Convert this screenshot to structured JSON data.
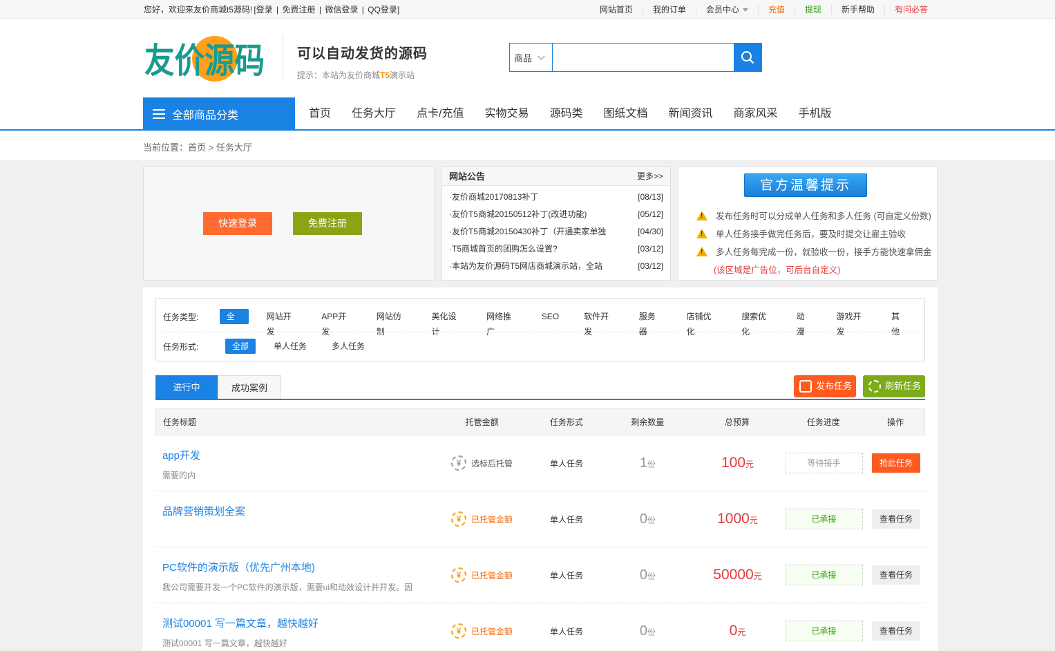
{
  "topbar": {
    "welcome": "您好，欢迎来友价商城t5源码!",
    "login": "[登录",
    "register": "免费注册",
    "wechat": "微信登录",
    "qq": "QQ登录]",
    "sep": "|",
    "nav": [
      "网站首页",
      "我的订单",
      "会员中心",
      "充值",
      "提现",
      "新手帮助",
      "有问必答"
    ]
  },
  "header": {
    "logo_text": "友价源码",
    "slogan": "可以自动发货的源码",
    "hint_prefix": "提示：本站为友价商城",
    "hint_brand": "T5",
    "hint_suffix": "演示站",
    "search_type": "商品",
    "search_placeholder": ""
  },
  "mainnav": {
    "all_categories": "全部商品分类",
    "items": [
      "首页",
      "任务大厅",
      "点卡/充值",
      "实物交易",
      "源码类",
      "图纸文档",
      "新闻资讯",
      "商家风采",
      "手机版"
    ]
  },
  "breadcrumb": "当前位置：首页 > 任务大厅",
  "login_panel": {
    "quick_login": "快速登录",
    "free_register": "免费注册"
  },
  "notice": {
    "title": "网站公告",
    "more": "更多>>",
    "items": [
      {
        "title": "·友价商城20170813补丁",
        "date": "[08/13]"
      },
      {
        "title": "·友价T5商城20150512补丁(改进功能)",
        "date": "[05/12]"
      },
      {
        "title": "·友价T5商城20150430补丁（开通卖家单独",
        "date": "[04/30]"
      },
      {
        "title": "·T5商城首页的团购怎么设置?",
        "date": "[03/12]"
      },
      {
        "title": "·本站为友价源码T5网店商城演示站，全站",
        "date": "[03/12]"
      }
    ]
  },
  "tips": {
    "title": "官方温馨提示",
    "items": [
      "发布任务时可以分成单人任务和多人任务 (可自定义份数)",
      "单人任务接手做完任务后，要及时提交让雇主验收",
      "多人任务每完成一份，就验收一份，接手方能快速拿佣金"
    ],
    "ad": "(该区域是广告位，可后台自定义)"
  },
  "filter": {
    "type_label": "任务类型:",
    "types": [
      "全部",
      "网站开发",
      "APP开发",
      "网站仿制",
      "美化设计",
      "网络推广",
      "SEO",
      "软件开发",
      "服务器",
      "店铺优化",
      "搜索优化",
      "动漫",
      "游戏开发",
      "其他"
    ],
    "form_label": "任务形式:",
    "forms": [
      "全部",
      "单人任务",
      "多人任务"
    ]
  },
  "tabs": {
    "active": "进行中",
    "cases": "成功案例"
  },
  "actions": {
    "publish": "发布任务",
    "refresh": "刷新任务"
  },
  "table": {
    "headers": [
      "任务标题",
      "托管金额",
      "任务形式",
      "剩余数量",
      "总预算",
      "任务进度",
      "操作"
    ],
    "unit_count": "份",
    "unit_money": "元",
    "rows": [
      {
        "title": "app开发",
        "desc": "需要的内",
        "hosting": "选标后托管",
        "form": "单人任务",
        "remaining": "1",
        "budget": "100",
        "status": "等待接手",
        "action": "抢此任务"
      },
      {
        "title": "品牌营销策划全案",
        "desc": "",
        "hosting": "已托管金额",
        "form": "单人任务",
        "remaining": "0",
        "budget": "1000",
        "status": "已承接",
        "action": "查看任务"
      },
      {
        "title": "PC软件的演示版（优先广州本地)",
        "desc": "我公司需要开发一个PC软件的演示版，需要ui和动效设计并开发。因",
        "hosting": "已托管金额",
        "form": "单人任务",
        "remaining": "0",
        "budget": "50000",
        "status": "已承接",
        "action": "查看任务"
      },
      {
        "title": "测试00001 写一篇文章，越快越好",
        "desc": "测试00001 写一篇文章，越快越好",
        "hosting": "已托管金额",
        "form": "单人任务",
        "remaining": "0",
        "budget": "0",
        "status": "已承接",
        "action": "查看任务"
      }
    ]
  },
  "colors": {
    "accent": "#1982e3",
    "orange": "#ff5a1f",
    "green": "#7cab1a",
    "price": "#e4393c"
  }
}
